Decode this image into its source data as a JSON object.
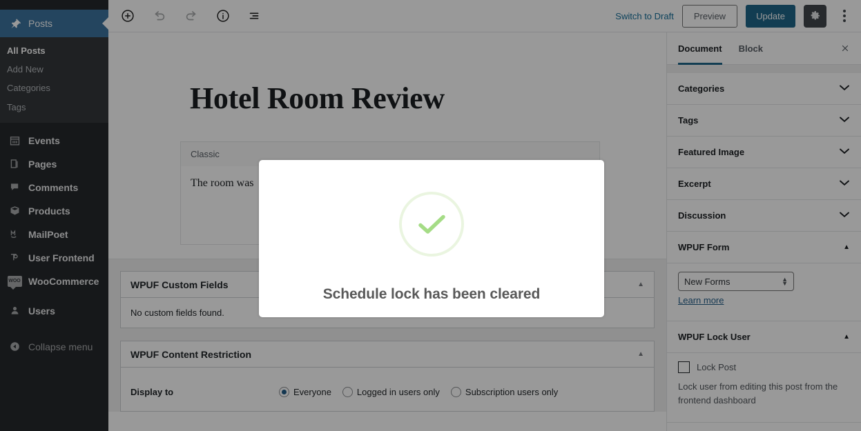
{
  "admin_sidebar": {
    "active_menu": {
      "label": "Posts",
      "icon": "pin-icon"
    },
    "submenu": [
      {
        "label": "All Posts",
        "current": true
      },
      {
        "label": "Add New",
        "current": false
      },
      {
        "label": "Categories",
        "current": false
      },
      {
        "label": "Tags",
        "current": false
      }
    ],
    "menu_items": [
      {
        "label": "Events",
        "icon": "calendar-icon"
      },
      {
        "label": "Pages",
        "icon": "pages-icon"
      },
      {
        "label": "Comments",
        "icon": "comment-icon"
      },
      {
        "label": "Products",
        "icon": "box-icon"
      },
      {
        "label": "MailPoet",
        "icon": "mailpoet-icon"
      },
      {
        "label": "User Frontend",
        "icon": "user-frontend-icon"
      },
      {
        "label": "WooCommerce",
        "icon": "woo-icon",
        "badge_text": "WOO"
      },
      {
        "label": "Users",
        "icon": "user-icon"
      }
    ],
    "collapse": {
      "label": "Collapse menu",
      "icon": "collapse-arrow-icon"
    },
    "active_bg": "#2e76ad",
    "bg": "#23282d",
    "submenu_bg": "#32373c"
  },
  "header": {
    "left_tools": [
      {
        "name": "add-block-button",
        "icon": "plus-circle-icon",
        "disabled": false
      },
      {
        "name": "undo-button",
        "icon": "undo-icon",
        "disabled": true
      },
      {
        "name": "redo-button",
        "icon": "redo-icon",
        "disabled": true
      },
      {
        "name": "details-button",
        "icon": "info-circle-icon",
        "disabled": false
      },
      {
        "name": "list-view-button",
        "icon": "list-view-icon",
        "disabled": false
      }
    ],
    "switch_to_draft": "Switch to Draft",
    "preview": "Preview",
    "update": "Update",
    "settings_icon": "gear-icon",
    "more_options_icon": "kebab-vertical-icon",
    "update_bg": "#0e6a95",
    "link_color": "#0073aa"
  },
  "editor": {
    "post_title": "Hotel Room Review",
    "classic_block_label": "Classic",
    "classic_block_content": "The room was",
    "metaboxes": [
      {
        "title": "WPUF Custom Fields",
        "toggle_icon": "chevron-up-icon",
        "body_text": "No custom fields found."
      },
      {
        "title": "WPUF Content Restriction",
        "toggle_icon": "chevron-up-icon",
        "field_label": "Display to",
        "radios": [
          {
            "label": "Everyone",
            "checked": true
          },
          {
            "label": "Logged in users only",
            "checked": false
          },
          {
            "label": "Subscription users only",
            "checked": false
          }
        ]
      }
    ]
  },
  "settings_sidebar": {
    "tabs": [
      {
        "label": "Document",
        "active": true
      },
      {
        "label": "Block",
        "active": false
      }
    ],
    "close_icon": "close-icon",
    "active_tab_underline": "#0e6a95",
    "panels": [
      {
        "label": "Categories",
        "state": "collapsed",
        "icon": "chevron-down-icon"
      },
      {
        "label": "Tags",
        "state": "collapsed",
        "icon": "chevron-down-icon"
      },
      {
        "label": "Featured Image",
        "state": "collapsed",
        "icon": "chevron-down-icon"
      },
      {
        "label": "Excerpt",
        "state": "collapsed",
        "icon": "chevron-down-icon"
      },
      {
        "label": "Discussion",
        "state": "collapsed",
        "icon": "chevron-down-icon"
      }
    ],
    "wpuf_form": {
      "label": "WPUF Form",
      "state": "expanded",
      "icon": "chevron-up-icon",
      "select_value": "New Forms",
      "link_label": "Learn more"
    },
    "wpuf_lock_user": {
      "label": "WPUF Lock User",
      "state": "expanded",
      "icon": "chevron-up-icon",
      "checkbox_label": "Lock Post",
      "checkbox_checked": false,
      "helper_text": "Lock user from editing this post from the frontend dashboard"
    }
  },
  "modal": {
    "icon": "success-check-icon",
    "message": "Schedule lock has been cleared",
    "check_color": "#a5dc86",
    "ring_color": "#eaf5e0"
  }
}
